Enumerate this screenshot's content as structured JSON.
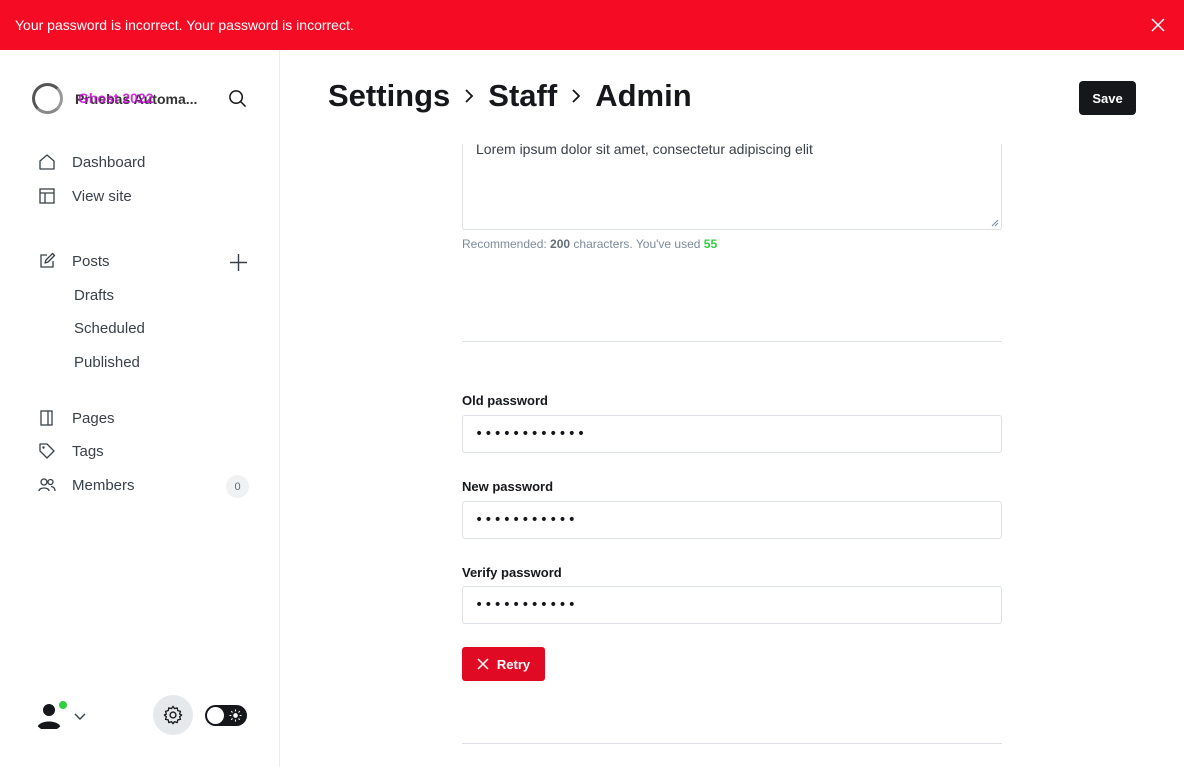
{
  "alert": {
    "message": "Your password is incorrect. Your password is incorrect.",
    "background": "#f50b23"
  },
  "brand": {
    "title": "Pruebas Automa...",
    "overlay_title": "Ghost 2022"
  },
  "sidebar": {
    "items": [
      {
        "label": "Dashboard",
        "icon": "home-icon"
      },
      {
        "label": "View site",
        "icon": "layout-icon"
      },
      {
        "label": "Posts",
        "icon": "edit-icon"
      },
      {
        "label": "Pages",
        "icon": "pages-icon"
      },
      {
        "label": "Tags",
        "icon": "tag-icon"
      },
      {
        "label": "Members",
        "icon": "members-icon",
        "count": "0"
      }
    ],
    "post_subitems": [
      "Drafts",
      "Scheduled",
      "Published"
    ]
  },
  "header": {
    "crumbs": [
      "Settings",
      "Staff",
      "Admin"
    ],
    "save_label": "Save"
  },
  "bio": {
    "text": "Lorem ipsum dolor sit amet, consectetur adipiscing elit",
    "hint_prefix": "Recommended: ",
    "hint_recommended": "200",
    "hint_middle": " characters. You've used ",
    "hint_used": "55"
  },
  "password": {
    "old_label": "Old password",
    "old_value": "••••••••••••",
    "new_label": "New password",
    "new_value": "•••••••••••",
    "verify_label": "Verify password",
    "verify_value": "•••••••••••",
    "retry_label": "Retry"
  },
  "colors": {
    "accent_error": "#e10a24",
    "success": "#30cf43",
    "dark": "#15171a"
  }
}
